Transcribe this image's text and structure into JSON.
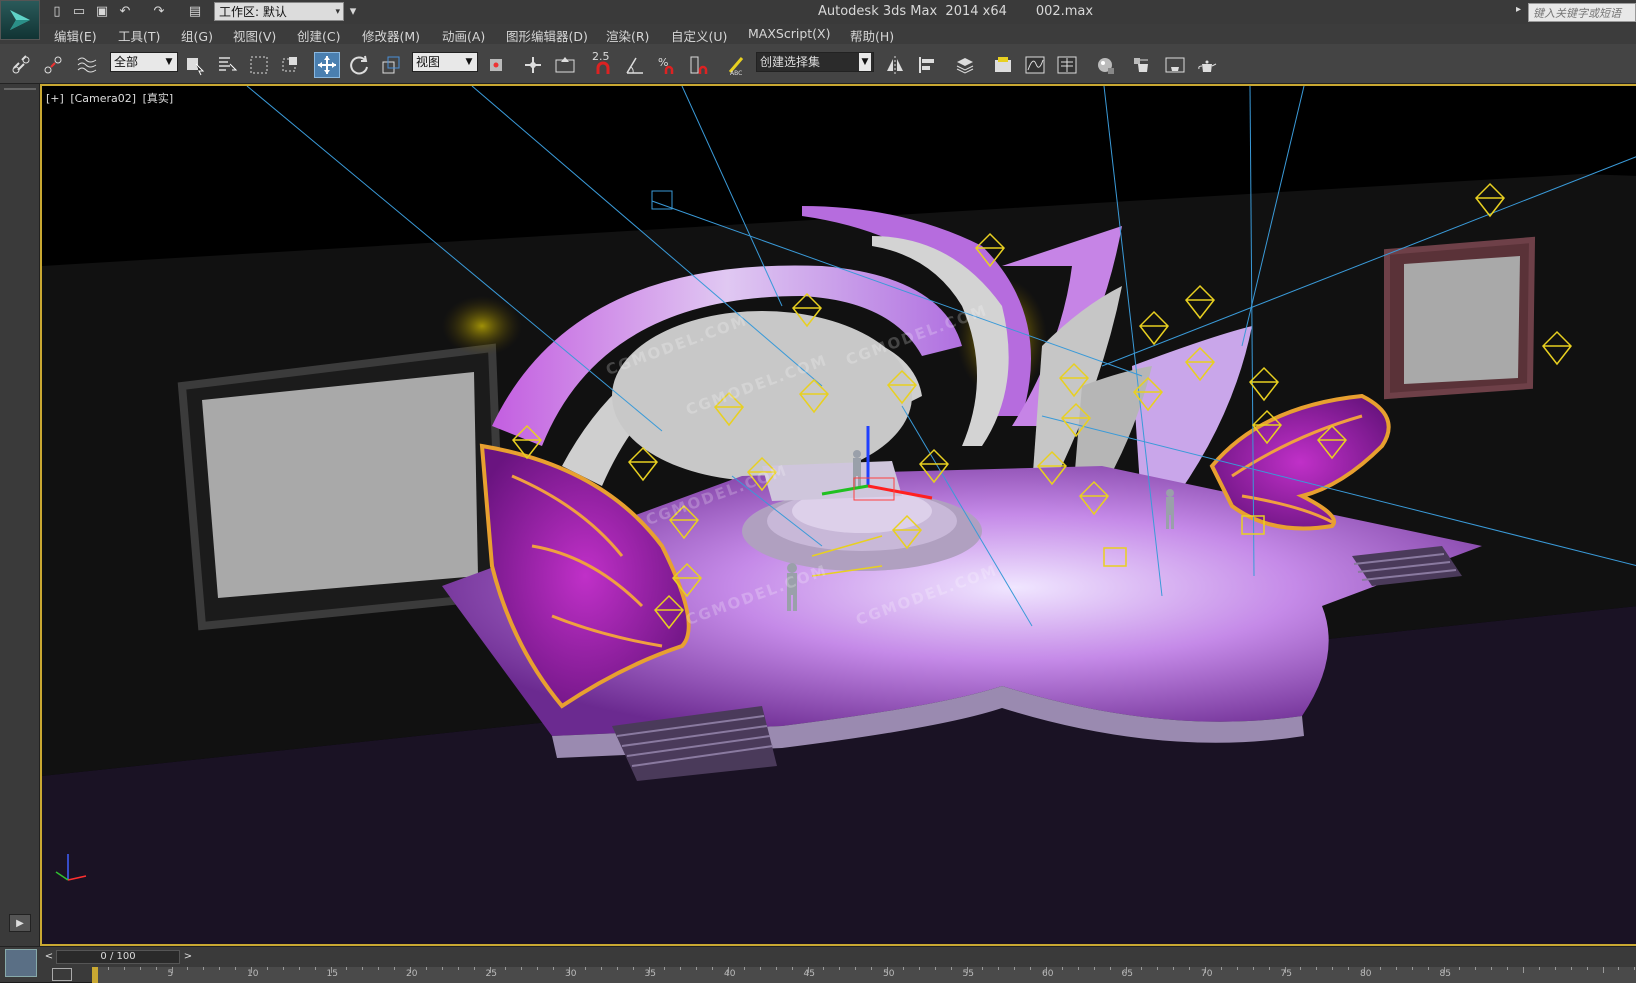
{
  "titlebar": {
    "workspace": "工作区: 默认",
    "title": "Autodesk 3ds Max  2014 x64       002.max",
    "search_placeholder": "键入关键字或短语"
  },
  "menu": [
    {
      "label": "编辑(E)"
    },
    {
      "label": "工具(T)"
    },
    {
      "label": "组(G)"
    },
    {
      "label": "视图(V)"
    },
    {
      "label": "创建(C)"
    },
    {
      "label": "修改器(M)"
    },
    {
      "label": "动画(A)"
    },
    {
      "label": "图形编辑器(D)"
    },
    {
      "label": "渲染(R)"
    },
    {
      "label": "自定义(U)"
    },
    {
      "label": "MAXScript(X)"
    },
    {
      "label": "帮助(H)"
    }
  ],
  "toolbar": {
    "selection_filter": "全部",
    "ref_coord": "视图",
    "named_selection": "创建选择集",
    "snap_value": "2.5"
  },
  "viewport": {
    "label_plus": "[+]",
    "label_camera": "[Camera02]",
    "label_shading": "[真实]",
    "watermark": "CGMODEL.COM"
  },
  "timeline": {
    "frame": "0 / 100",
    "prev": "<",
    "next": ">",
    "ruler": [
      "5",
      "10",
      "15",
      "20",
      "25",
      "30",
      "35",
      "40",
      "45",
      "50",
      "55",
      "60",
      "65",
      "70",
      "75",
      "80",
      "85"
    ]
  },
  "colors": {
    "accent_active": "#4a7fb0",
    "viewport_border": "#c9a832",
    "stage_purple": "#b04bd0",
    "light_yellow": "#e8d020"
  },
  "icons": {
    "app": "3dsmax-logo-icon",
    "move": "move-icon",
    "rotate": "rotate-icon",
    "scale": "scale-icon"
  }
}
